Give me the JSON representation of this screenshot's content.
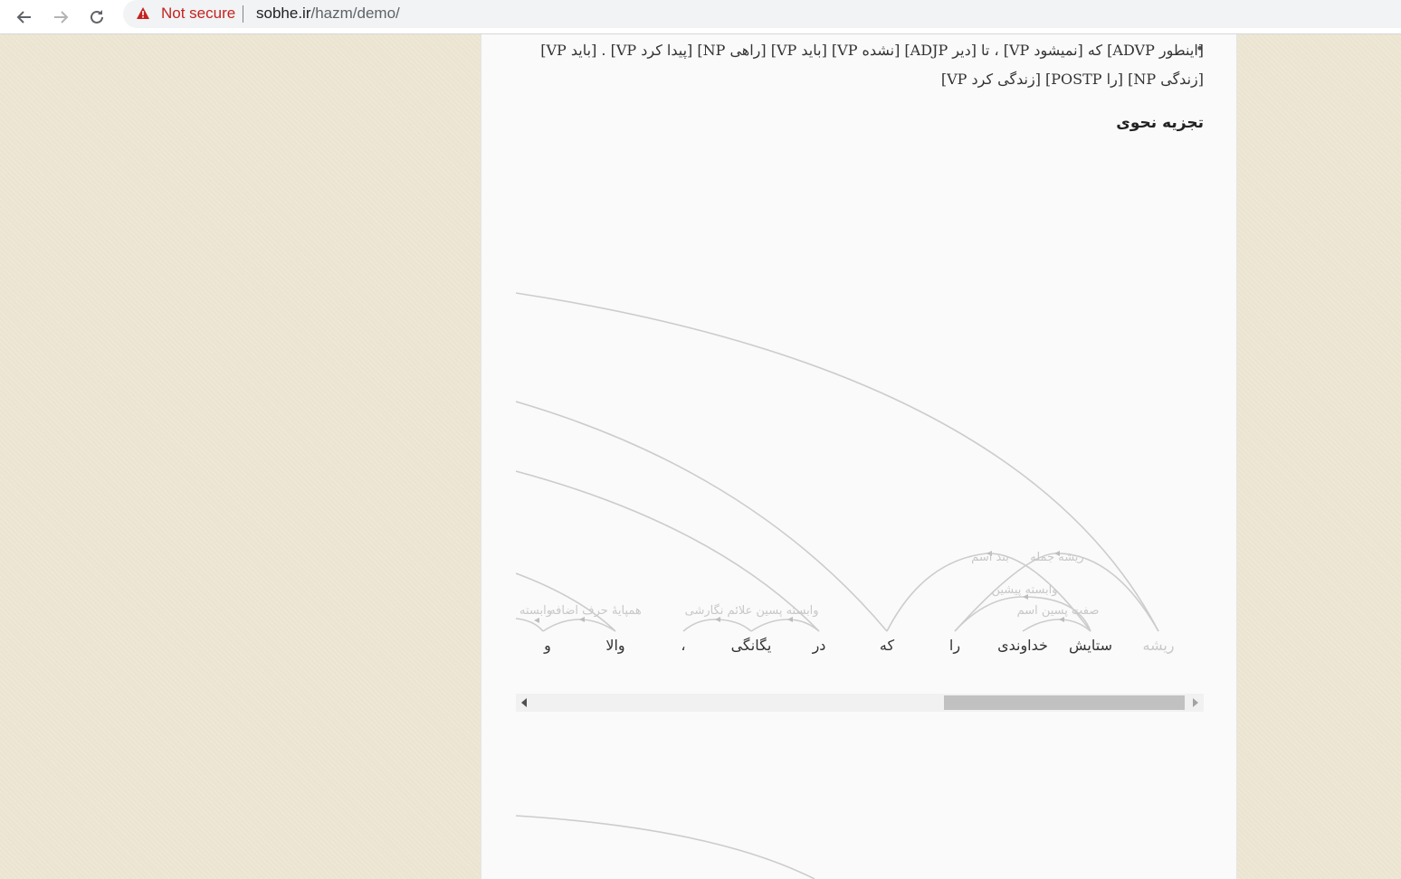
{
  "browser": {
    "security_label": "Not secure",
    "url_host": "sobhe.ir",
    "url_path": "/hazm/demo/"
  },
  "chunker": {
    "text": "[اینطور ADVP] که [نمیشود VP] ، تا [دیر ADJP] [نشده VP] [باید VP] [راهی NP] [پیدا کرد VP] . [باید VP] [زندگی NP] [را POSTP] [زندگی کرد VP]"
  },
  "parser": {
    "heading": "تجزیه نحوی",
    "words": [
      "ریشه",
      "ستایش",
      "خداوندی",
      "را",
      "که",
      "در",
      "یگانگی",
      "،",
      "والا",
      "و"
    ],
    "arc_labels": {
      "root_sentence": "ریشه جمله",
      "noun_clause": "بند اسم",
      "pre_dependent": "وابسته پیشین",
      "post_adj": "صفت پسین اسم",
      "post_dep": "وابسته پسین",
      "punct": "علائم نگارشی",
      "coord": "همپایهٔ حرف اضافه",
      "dependent": "وابسته"
    }
  },
  "colors": {
    "page_bg": "#ebe4d1",
    "panel_bg": "#fafafa",
    "arc": "#cccccc",
    "warning": "#c5221f"
  }
}
